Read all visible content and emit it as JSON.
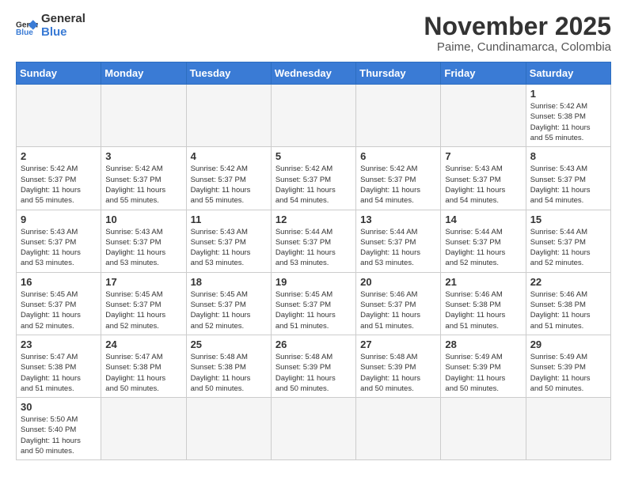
{
  "logo": {
    "text_general": "General",
    "text_blue": "Blue"
  },
  "title": "November 2025",
  "subtitle": "Paime, Cundinamarca, Colombia",
  "weekdays": [
    "Sunday",
    "Monday",
    "Tuesday",
    "Wednesday",
    "Thursday",
    "Friday",
    "Saturday"
  ],
  "weeks": [
    [
      {
        "day": "",
        "info": ""
      },
      {
        "day": "",
        "info": ""
      },
      {
        "day": "",
        "info": ""
      },
      {
        "day": "",
        "info": ""
      },
      {
        "day": "",
        "info": ""
      },
      {
        "day": "",
        "info": ""
      },
      {
        "day": "1",
        "info": "Sunrise: 5:42 AM\nSunset: 5:38 PM\nDaylight: 11 hours\nand 55 minutes."
      }
    ],
    [
      {
        "day": "2",
        "info": "Sunrise: 5:42 AM\nSunset: 5:37 PM\nDaylight: 11 hours\nand 55 minutes."
      },
      {
        "day": "3",
        "info": "Sunrise: 5:42 AM\nSunset: 5:37 PM\nDaylight: 11 hours\nand 55 minutes."
      },
      {
        "day": "4",
        "info": "Sunrise: 5:42 AM\nSunset: 5:37 PM\nDaylight: 11 hours\nand 55 minutes."
      },
      {
        "day": "5",
        "info": "Sunrise: 5:42 AM\nSunset: 5:37 PM\nDaylight: 11 hours\nand 54 minutes."
      },
      {
        "day": "6",
        "info": "Sunrise: 5:42 AM\nSunset: 5:37 PM\nDaylight: 11 hours\nand 54 minutes."
      },
      {
        "day": "7",
        "info": "Sunrise: 5:43 AM\nSunset: 5:37 PM\nDaylight: 11 hours\nand 54 minutes."
      },
      {
        "day": "8",
        "info": "Sunrise: 5:43 AM\nSunset: 5:37 PM\nDaylight: 11 hours\nand 54 minutes."
      }
    ],
    [
      {
        "day": "9",
        "info": "Sunrise: 5:43 AM\nSunset: 5:37 PM\nDaylight: 11 hours\nand 53 minutes."
      },
      {
        "day": "10",
        "info": "Sunrise: 5:43 AM\nSunset: 5:37 PM\nDaylight: 11 hours\nand 53 minutes."
      },
      {
        "day": "11",
        "info": "Sunrise: 5:43 AM\nSunset: 5:37 PM\nDaylight: 11 hours\nand 53 minutes."
      },
      {
        "day": "12",
        "info": "Sunrise: 5:44 AM\nSunset: 5:37 PM\nDaylight: 11 hours\nand 53 minutes."
      },
      {
        "day": "13",
        "info": "Sunrise: 5:44 AM\nSunset: 5:37 PM\nDaylight: 11 hours\nand 53 minutes."
      },
      {
        "day": "14",
        "info": "Sunrise: 5:44 AM\nSunset: 5:37 PM\nDaylight: 11 hours\nand 52 minutes."
      },
      {
        "day": "15",
        "info": "Sunrise: 5:44 AM\nSunset: 5:37 PM\nDaylight: 11 hours\nand 52 minutes."
      }
    ],
    [
      {
        "day": "16",
        "info": "Sunrise: 5:45 AM\nSunset: 5:37 PM\nDaylight: 11 hours\nand 52 minutes."
      },
      {
        "day": "17",
        "info": "Sunrise: 5:45 AM\nSunset: 5:37 PM\nDaylight: 11 hours\nand 52 minutes."
      },
      {
        "day": "18",
        "info": "Sunrise: 5:45 AM\nSunset: 5:37 PM\nDaylight: 11 hours\nand 52 minutes."
      },
      {
        "day": "19",
        "info": "Sunrise: 5:45 AM\nSunset: 5:37 PM\nDaylight: 11 hours\nand 51 minutes."
      },
      {
        "day": "20",
        "info": "Sunrise: 5:46 AM\nSunset: 5:37 PM\nDaylight: 11 hours\nand 51 minutes."
      },
      {
        "day": "21",
        "info": "Sunrise: 5:46 AM\nSunset: 5:38 PM\nDaylight: 11 hours\nand 51 minutes."
      },
      {
        "day": "22",
        "info": "Sunrise: 5:46 AM\nSunset: 5:38 PM\nDaylight: 11 hours\nand 51 minutes."
      }
    ],
    [
      {
        "day": "23",
        "info": "Sunrise: 5:47 AM\nSunset: 5:38 PM\nDaylight: 11 hours\nand 51 minutes."
      },
      {
        "day": "24",
        "info": "Sunrise: 5:47 AM\nSunset: 5:38 PM\nDaylight: 11 hours\nand 50 minutes."
      },
      {
        "day": "25",
        "info": "Sunrise: 5:48 AM\nSunset: 5:38 PM\nDaylight: 11 hours\nand 50 minutes."
      },
      {
        "day": "26",
        "info": "Sunrise: 5:48 AM\nSunset: 5:39 PM\nDaylight: 11 hours\nand 50 minutes."
      },
      {
        "day": "27",
        "info": "Sunrise: 5:48 AM\nSunset: 5:39 PM\nDaylight: 11 hours\nand 50 minutes."
      },
      {
        "day": "28",
        "info": "Sunrise: 5:49 AM\nSunset: 5:39 PM\nDaylight: 11 hours\nand 50 minutes."
      },
      {
        "day": "29",
        "info": "Sunrise: 5:49 AM\nSunset: 5:39 PM\nDaylight: 11 hours\nand 50 minutes."
      }
    ],
    [
      {
        "day": "30",
        "info": "Sunrise: 5:50 AM\nSunset: 5:40 PM\nDaylight: 11 hours\nand 50 minutes."
      },
      {
        "day": "",
        "info": ""
      },
      {
        "day": "",
        "info": ""
      },
      {
        "day": "",
        "info": ""
      },
      {
        "day": "",
        "info": ""
      },
      {
        "day": "",
        "info": ""
      },
      {
        "day": "",
        "info": ""
      }
    ]
  ]
}
